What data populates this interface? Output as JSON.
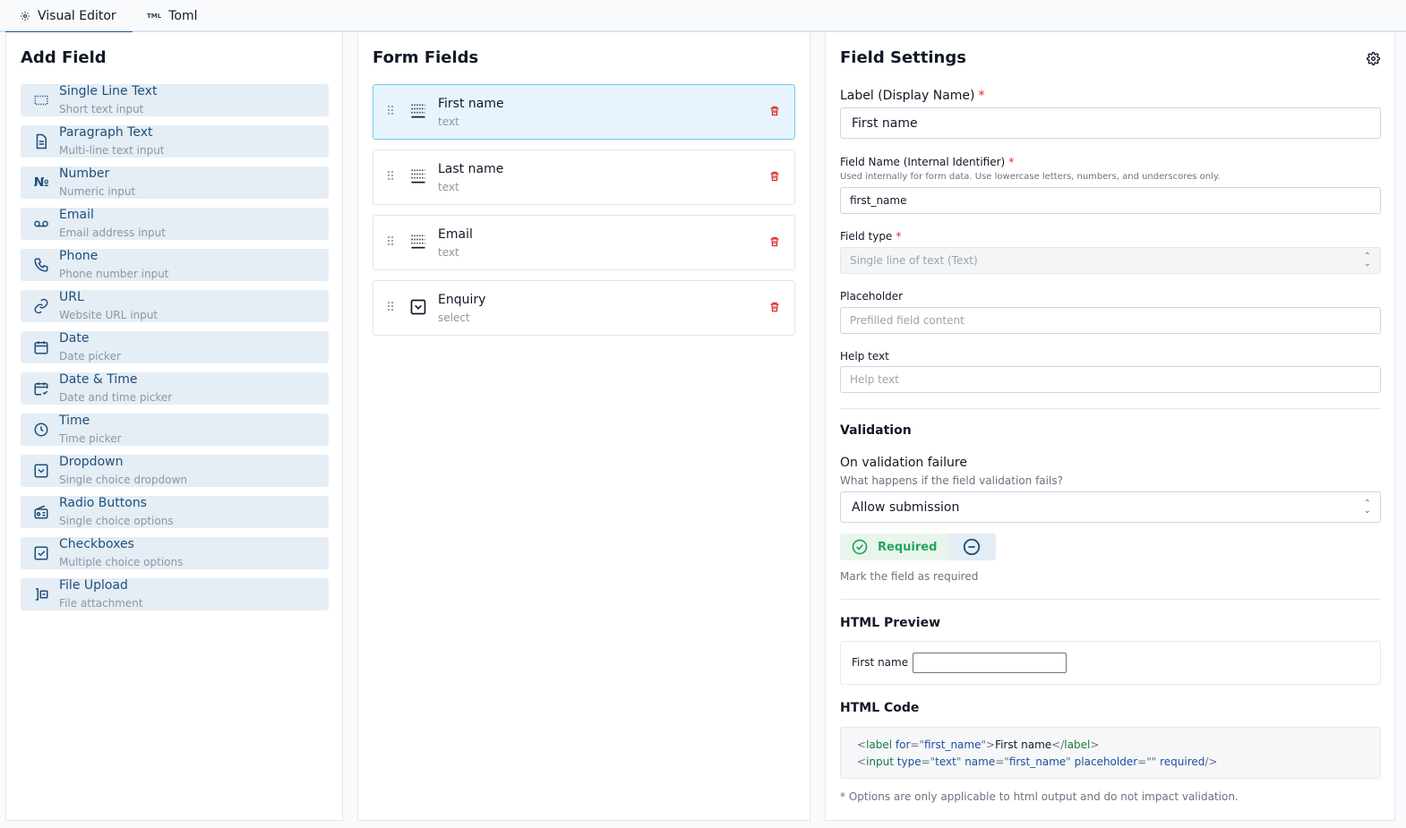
{
  "tabs": [
    {
      "label": "Visual Editor",
      "icon": "settings-icon",
      "active": true
    },
    {
      "label": "Toml",
      "icon": "toml-icon",
      "active": false
    }
  ],
  "add_field": {
    "title": "Add Field",
    "items": [
      {
        "name": "Single Line Text",
        "desc": "Short text input",
        "icon": "text-cursor-icon"
      },
      {
        "name": "Paragraph Text",
        "desc": "Multi-line text input",
        "icon": "file-text-icon"
      },
      {
        "name": "Number",
        "desc": "Numeric input",
        "icon": "numero-icon"
      },
      {
        "name": "Email",
        "desc": "Email address input",
        "icon": "voicemail-icon"
      },
      {
        "name": "Phone",
        "desc": "Phone number input",
        "icon": "phone-icon"
      },
      {
        "name": "URL",
        "desc": "Website URL input",
        "icon": "link-icon"
      },
      {
        "name": "Date",
        "desc": "Date picker",
        "icon": "calendar-icon"
      },
      {
        "name": "Date & Time",
        "desc": "Date and time picker",
        "icon": "calendar-clock-icon"
      },
      {
        "name": "Time",
        "desc": "Time picker",
        "icon": "clock-icon"
      },
      {
        "name": "Dropdown",
        "desc": "Single choice dropdown",
        "icon": "chevron-square-icon"
      },
      {
        "name": "Radio Buttons",
        "desc": "Single choice options",
        "icon": "radio-icon"
      },
      {
        "name": "Checkboxes",
        "desc": "Multiple choice options",
        "icon": "check-square-icon"
      },
      {
        "name": "File Upload",
        "desc": "File attachment",
        "icon": "file-upload-icon"
      }
    ]
  },
  "form_fields": {
    "title": "Form Fields",
    "items": [
      {
        "name": "First name",
        "type": "text",
        "selected": true
      },
      {
        "name": "Last name",
        "type": "text",
        "selected": false
      },
      {
        "name": "Email",
        "type": "text",
        "selected": false
      },
      {
        "name": "Enquiry",
        "type": "select",
        "selected": false
      }
    ]
  },
  "settings": {
    "title": "Field Settings",
    "label_label": "Label (Display Name)",
    "label_value": "First name",
    "fieldname_label": "Field Name (Internal Identifier)",
    "fieldname_hint": "Used internally for form data. Use lowercase letters, numbers, and underscores only.",
    "fieldname_value": "first_name",
    "fieldtype_label": "Field type",
    "fieldtype_value": "Single line of text (Text)",
    "placeholder_label": "Placeholder",
    "placeholder_placeholder": "Prefilled field content",
    "helptext_label": "Help text",
    "helptext_placeholder": "Help text",
    "required_mark": "*",
    "validation_title": "Validation",
    "on_failure_label": "On validation failure",
    "on_failure_hint": "What happens if the field validation fails?",
    "on_failure_value": "Allow submission",
    "required_label": "Required",
    "required_hint": "Mark the field as required",
    "preview_title": "HTML Preview",
    "preview_label": "First name",
    "code_title": "HTML Code",
    "code": {
      "label_for": "first_name",
      "label_text": "First name",
      "input_type": "text",
      "input_name": "first_name",
      "input_placeholder": ""
    },
    "footnote": "* Options are only applicable to html output and do not impact validation."
  },
  "colors": {
    "accent": "#1e4f7a",
    "danger": "#dc2626",
    "success": "#22a65a",
    "selected_bg": "#e8f4fd"
  }
}
